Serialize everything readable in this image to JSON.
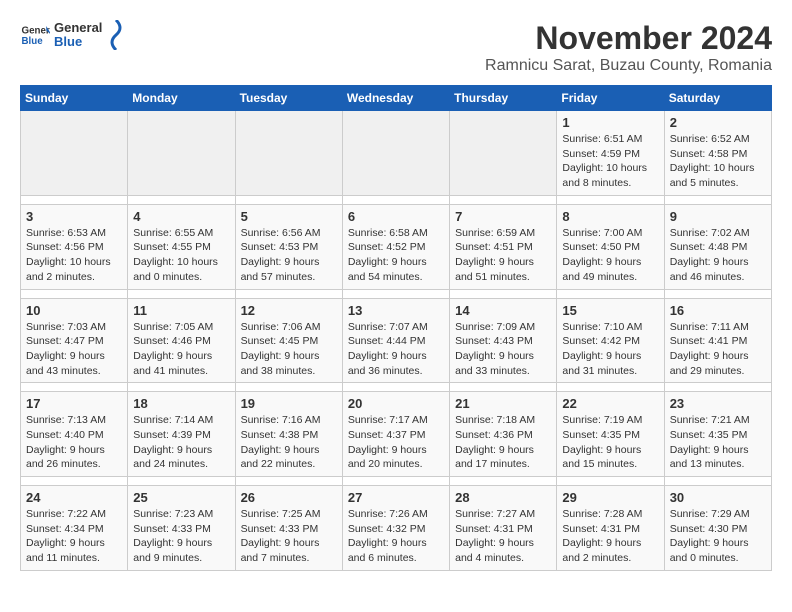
{
  "logo": {
    "text_general": "General",
    "text_blue": "Blue"
  },
  "title": "November 2024",
  "subtitle": "Ramnicu Sarat, Buzau County, Romania",
  "days_of_week": [
    "Sunday",
    "Monday",
    "Tuesday",
    "Wednesday",
    "Thursday",
    "Friday",
    "Saturday"
  ],
  "weeks": [
    {
      "days": [
        {
          "num": "",
          "info": ""
        },
        {
          "num": "",
          "info": ""
        },
        {
          "num": "",
          "info": ""
        },
        {
          "num": "",
          "info": ""
        },
        {
          "num": "",
          "info": ""
        },
        {
          "num": "1",
          "info": "Sunrise: 6:51 AM\nSunset: 4:59 PM\nDaylight: 10 hours\nand 8 minutes."
        },
        {
          "num": "2",
          "info": "Sunrise: 6:52 AM\nSunset: 4:58 PM\nDaylight: 10 hours\nand 5 minutes."
        }
      ]
    },
    {
      "days": [
        {
          "num": "3",
          "info": "Sunrise: 6:53 AM\nSunset: 4:56 PM\nDaylight: 10 hours\nand 2 minutes."
        },
        {
          "num": "4",
          "info": "Sunrise: 6:55 AM\nSunset: 4:55 PM\nDaylight: 10 hours\nand 0 minutes."
        },
        {
          "num": "5",
          "info": "Sunrise: 6:56 AM\nSunset: 4:53 PM\nDaylight: 9 hours\nand 57 minutes."
        },
        {
          "num": "6",
          "info": "Sunrise: 6:58 AM\nSunset: 4:52 PM\nDaylight: 9 hours\nand 54 minutes."
        },
        {
          "num": "7",
          "info": "Sunrise: 6:59 AM\nSunset: 4:51 PM\nDaylight: 9 hours\nand 51 minutes."
        },
        {
          "num": "8",
          "info": "Sunrise: 7:00 AM\nSunset: 4:50 PM\nDaylight: 9 hours\nand 49 minutes."
        },
        {
          "num": "9",
          "info": "Sunrise: 7:02 AM\nSunset: 4:48 PM\nDaylight: 9 hours\nand 46 minutes."
        }
      ]
    },
    {
      "days": [
        {
          "num": "10",
          "info": "Sunrise: 7:03 AM\nSunset: 4:47 PM\nDaylight: 9 hours\nand 43 minutes."
        },
        {
          "num": "11",
          "info": "Sunrise: 7:05 AM\nSunset: 4:46 PM\nDaylight: 9 hours\nand 41 minutes."
        },
        {
          "num": "12",
          "info": "Sunrise: 7:06 AM\nSunset: 4:45 PM\nDaylight: 9 hours\nand 38 minutes."
        },
        {
          "num": "13",
          "info": "Sunrise: 7:07 AM\nSunset: 4:44 PM\nDaylight: 9 hours\nand 36 minutes."
        },
        {
          "num": "14",
          "info": "Sunrise: 7:09 AM\nSunset: 4:43 PM\nDaylight: 9 hours\nand 33 minutes."
        },
        {
          "num": "15",
          "info": "Sunrise: 7:10 AM\nSunset: 4:42 PM\nDaylight: 9 hours\nand 31 minutes."
        },
        {
          "num": "16",
          "info": "Sunrise: 7:11 AM\nSunset: 4:41 PM\nDaylight: 9 hours\nand 29 minutes."
        }
      ]
    },
    {
      "days": [
        {
          "num": "17",
          "info": "Sunrise: 7:13 AM\nSunset: 4:40 PM\nDaylight: 9 hours\nand 26 minutes."
        },
        {
          "num": "18",
          "info": "Sunrise: 7:14 AM\nSunset: 4:39 PM\nDaylight: 9 hours\nand 24 minutes."
        },
        {
          "num": "19",
          "info": "Sunrise: 7:16 AM\nSunset: 4:38 PM\nDaylight: 9 hours\nand 22 minutes."
        },
        {
          "num": "20",
          "info": "Sunrise: 7:17 AM\nSunset: 4:37 PM\nDaylight: 9 hours\nand 20 minutes."
        },
        {
          "num": "21",
          "info": "Sunrise: 7:18 AM\nSunset: 4:36 PM\nDaylight: 9 hours\nand 17 minutes."
        },
        {
          "num": "22",
          "info": "Sunrise: 7:19 AM\nSunset: 4:35 PM\nDaylight: 9 hours\nand 15 minutes."
        },
        {
          "num": "23",
          "info": "Sunrise: 7:21 AM\nSunset: 4:35 PM\nDaylight: 9 hours\nand 13 minutes."
        }
      ]
    },
    {
      "days": [
        {
          "num": "24",
          "info": "Sunrise: 7:22 AM\nSunset: 4:34 PM\nDaylight: 9 hours\nand 11 minutes."
        },
        {
          "num": "25",
          "info": "Sunrise: 7:23 AM\nSunset: 4:33 PM\nDaylight: 9 hours\nand 9 minutes."
        },
        {
          "num": "26",
          "info": "Sunrise: 7:25 AM\nSunset: 4:33 PM\nDaylight: 9 hours\nand 7 minutes."
        },
        {
          "num": "27",
          "info": "Sunrise: 7:26 AM\nSunset: 4:32 PM\nDaylight: 9 hours\nand 6 minutes."
        },
        {
          "num": "28",
          "info": "Sunrise: 7:27 AM\nSunset: 4:31 PM\nDaylight: 9 hours\nand 4 minutes."
        },
        {
          "num": "29",
          "info": "Sunrise: 7:28 AM\nSunset: 4:31 PM\nDaylight: 9 hours\nand 2 minutes."
        },
        {
          "num": "30",
          "info": "Sunrise: 7:29 AM\nSunset: 4:30 PM\nDaylight: 9 hours\nand 0 minutes."
        }
      ]
    }
  ]
}
